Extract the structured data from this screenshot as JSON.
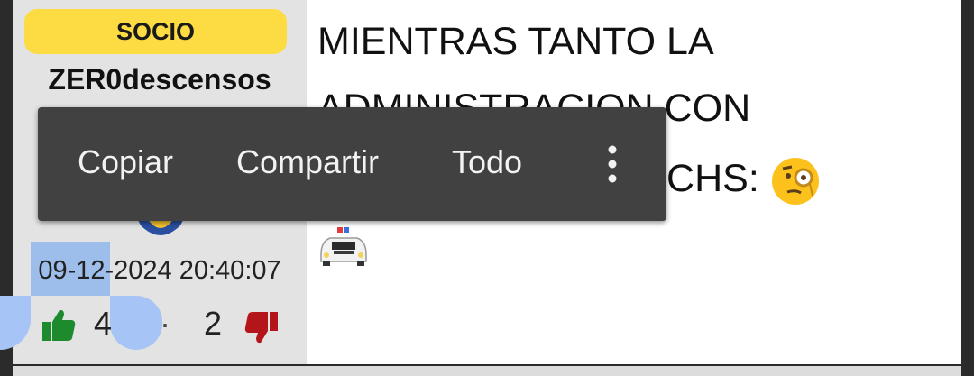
{
  "user_card": {
    "badge": "SOCIO",
    "username": "ZER0descensos",
    "datetime": "09-12-2024 20:40:07",
    "likes": "4",
    "separator": "·",
    "dislikes": "2"
  },
  "post": {
    "lines": [
      "MIENTRAS TANTO LA",
      "ADMINISTRACION CON",
      "LOS CHICOS MUNICHS:"
    ],
    "emojis": [
      "monocle-face",
      "police-car"
    ]
  },
  "context_menu": {
    "items": [
      "Copiar",
      "Compartir",
      "Todo"
    ],
    "more": "more-options-icon"
  },
  "colors": {
    "badge": "#fddc43",
    "sidebar": "#e3e3e3",
    "menu_bg": "#414141",
    "selection": "#a6c4f5",
    "like": "#1e8a2e",
    "dislike": "#b3151b"
  }
}
